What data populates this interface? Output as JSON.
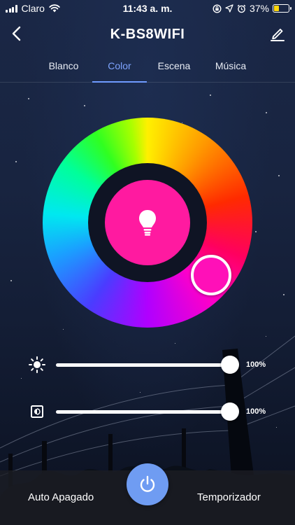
{
  "status_bar": {
    "carrier": "Claro",
    "time": "11:43 a. m.",
    "battery": "37%",
    "battery_level": 0.37,
    "battery_color": "#ffd60a"
  },
  "nav": {
    "title": "K-BS8WIFI",
    "back_icon": "chevron-left-icon",
    "edit_icon": "pencil-icon"
  },
  "tabs": [
    {
      "label": "Blanco",
      "active": false
    },
    {
      "label": "Color",
      "active": true
    },
    {
      "label": "Escena",
      "active": false
    },
    {
      "label": "Música",
      "active": false
    }
  ],
  "color_wheel": {
    "selected_color": "#ff1aa0",
    "center_icon": "lightbulb-icon"
  },
  "sliders": {
    "brightness": {
      "icon": "sun-icon",
      "value": "100%",
      "level": 1.0
    },
    "saturation": {
      "icon": "contrast-icon",
      "value": "100%",
      "level": 1.0
    }
  },
  "bottom_bar": {
    "auto_off": "Auto Apagado",
    "timer": "Temporizador",
    "power_icon": "power-icon",
    "power_color": "#6f9cf2"
  },
  "colors": {
    "accent": "#7ea4ff"
  }
}
